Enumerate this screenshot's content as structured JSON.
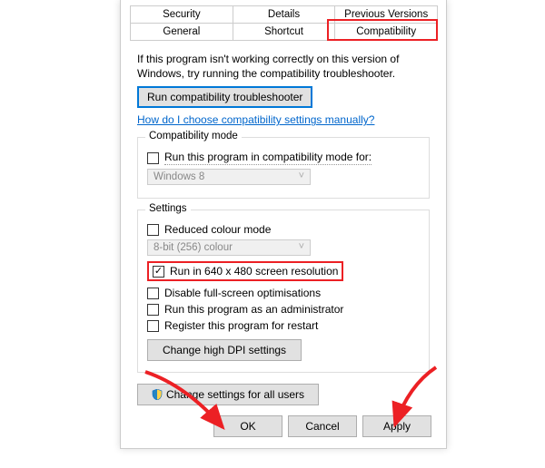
{
  "tabs": {
    "row1": [
      "Security",
      "Details",
      "Previous Versions"
    ],
    "row2": [
      "General",
      "Shortcut",
      "Compatibility"
    ]
  },
  "intro": "If this program isn't working correctly on this version of Windows, try running the compatibility troubleshooter.",
  "troubleshoot_btn": "Run compatibility troubleshooter",
  "help_link": "How do I choose compatibility settings manually?",
  "compat_mode": {
    "title": "Compatibility mode",
    "checkbox": "Run this program in compatibility mode for:",
    "select": "Windows 8"
  },
  "settings": {
    "title": "Settings",
    "reduced": "Reduced colour mode",
    "colour_select": "8-bit (256) colour",
    "run640": "Run in 640 x 480 screen resolution",
    "disable_fs": "Disable full-screen optimisations",
    "run_admin": "Run this program as an administrator",
    "register": "Register this program for restart",
    "dpi_btn": "Change high DPI settings"
  },
  "change_all": "Change settings for all users",
  "buttons": {
    "ok": "OK",
    "cancel": "Cancel",
    "apply": "Apply"
  }
}
